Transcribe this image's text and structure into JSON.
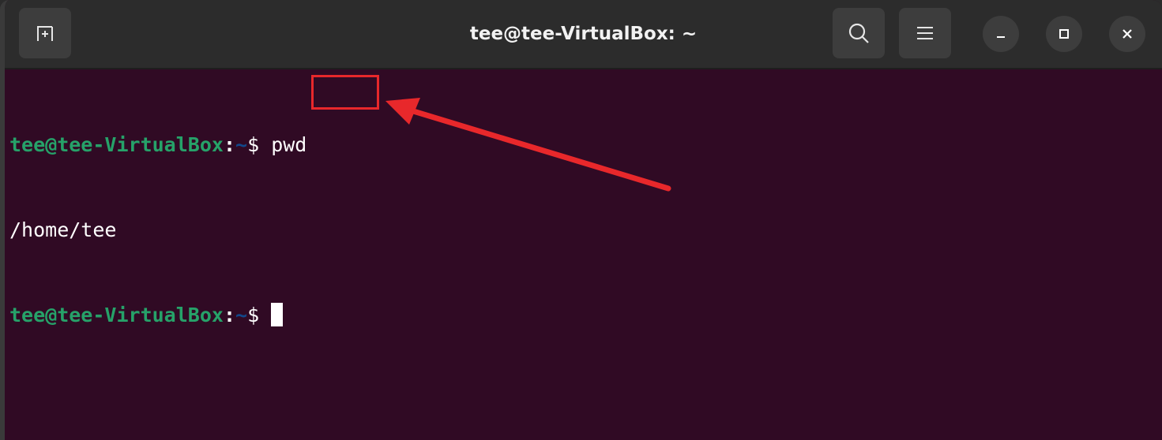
{
  "window": {
    "title": "tee@tee-VirtualBox: ~"
  },
  "titlebar": {
    "icons": {
      "new_tab": "new-tab-icon",
      "search": "search-icon",
      "menu": "hamburger-menu-icon",
      "minimize": "minimize-icon",
      "maximize": "maximize-icon",
      "close": "close-icon"
    }
  },
  "terminal": {
    "lines": [
      {
        "user_host": "tee@tee-VirtualBox",
        "colon": ":",
        "path": "~",
        "dollar": "$",
        "command": "pwd"
      },
      {
        "output": "/home/tee"
      },
      {
        "user_host": "tee@tee-VirtualBox",
        "colon": ":",
        "path": "~",
        "dollar": "$",
        "command": ""
      }
    ]
  },
  "colors": {
    "terminal_bg": "#300a24",
    "prompt_user": "#26a269",
    "prompt_path": "#12488b",
    "annotation": "#e8282b",
    "titlebar_bg": "#2c2c2c"
  }
}
